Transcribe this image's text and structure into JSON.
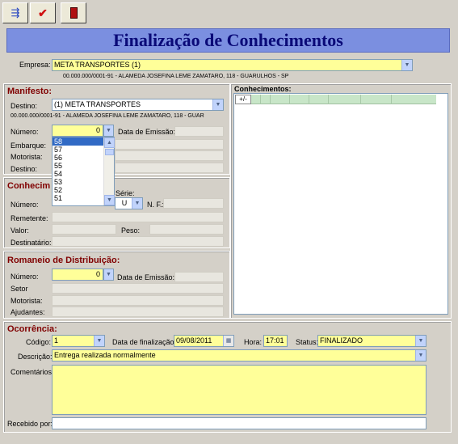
{
  "toolbar": {
    "buttons": [
      {
        "name": "sort-options-icon",
        "glyph": "⇶"
      },
      {
        "name": "confirm-check-icon",
        "glyph": "✔"
      },
      {
        "name": "exit-door-icon",
        "glyph": "▮"
      }
    ]
  },
  "title": "Finalização de Conhecimentos",
  "empresa": {
    "label": "Empresa:",
    "value": "META TRANSPORTES (1)",
    "address": "00.000.000/0001-91 - ALAMEDA JOSEFINA LEME ZAMATARO, 118 - GUARULHOS - SP"
  },
  "manifesto": {
    "title": "Manifesto:",
    "destino_label": "Destino:",
    "destino_value": "(1) META TRANSPORTES",
    "destino_address": "00.000.000/0001-91 - ALAMEDA JOSEFINA LEME ZAMATARO, 118 - GUAR",
    "numero_label": "Número:",
    "numero_value": "0",
    "data_emissao_label": "Data de Emissão:",
    "embarque_label": "Embarque:",
    "motorista_label": "Motorista:",
    "destino2_label": "Destino:",
    "dropdown_options": [
      "58",
      "57",
      "56",
      "55",
      "54",
      "53",
      "52",
      "51"
    ],
    "selected_option": "58"
  },
  "conhecimento": {
    "title": "Conhecim",
    "numero_label": "Número:",
    "serie_label": "Série:",
    "serie_value": "U",
    "nf_label": "N. F.:",
    "remetente_label": "Remetente:",
    "valor_label": "Valor:",
    "peso_label": "Peso:",
    "destinatario_label": "Destinatário:"
  },
  "conhecimentos_grid": {
    "title": "Conhecimentos:",
    "toggle_label": "+/-"
  },
  "romaneio": {
    "title": "Romaneio de Distribuição:",
    "numero_label": "Número:",
    "numero_value": "0",
    "data_emissao_label": "Data de Emissão:",
    "setor_label": "Setor",
    "motorista_label": "Motorista:",
    "ajudantes_label": "Ajudantes:"
  },
  "ocorrencia": {
    "title": "Ocorrência:",
    "codigo_label": "Código:",
    "codigo_value": "1",
    "data_finalizacao_label": "Data de finalização:",
    "data_finalizacao_value": "09/08/2011",
    "hora_label": "Hora:",
    "hora_value": "17:01",
    "status_label": "Status:",
    "status_value": "FINALIZADO",
    "descricao_label": "Descrição:",
    "descricao_value": "Entrega realizada normalmente",
    "comentarios_label": "Comentários:",
    "recebido_label": "Recebido por:"
  },
  "colors": {
    "title_bg": "#7b8fe0",
    "title_text": "#0a0a78",
    "section_title": "#800000",
    "field_yellow": "#ffff99",
    "selection": "#316ac5"
  }
}
